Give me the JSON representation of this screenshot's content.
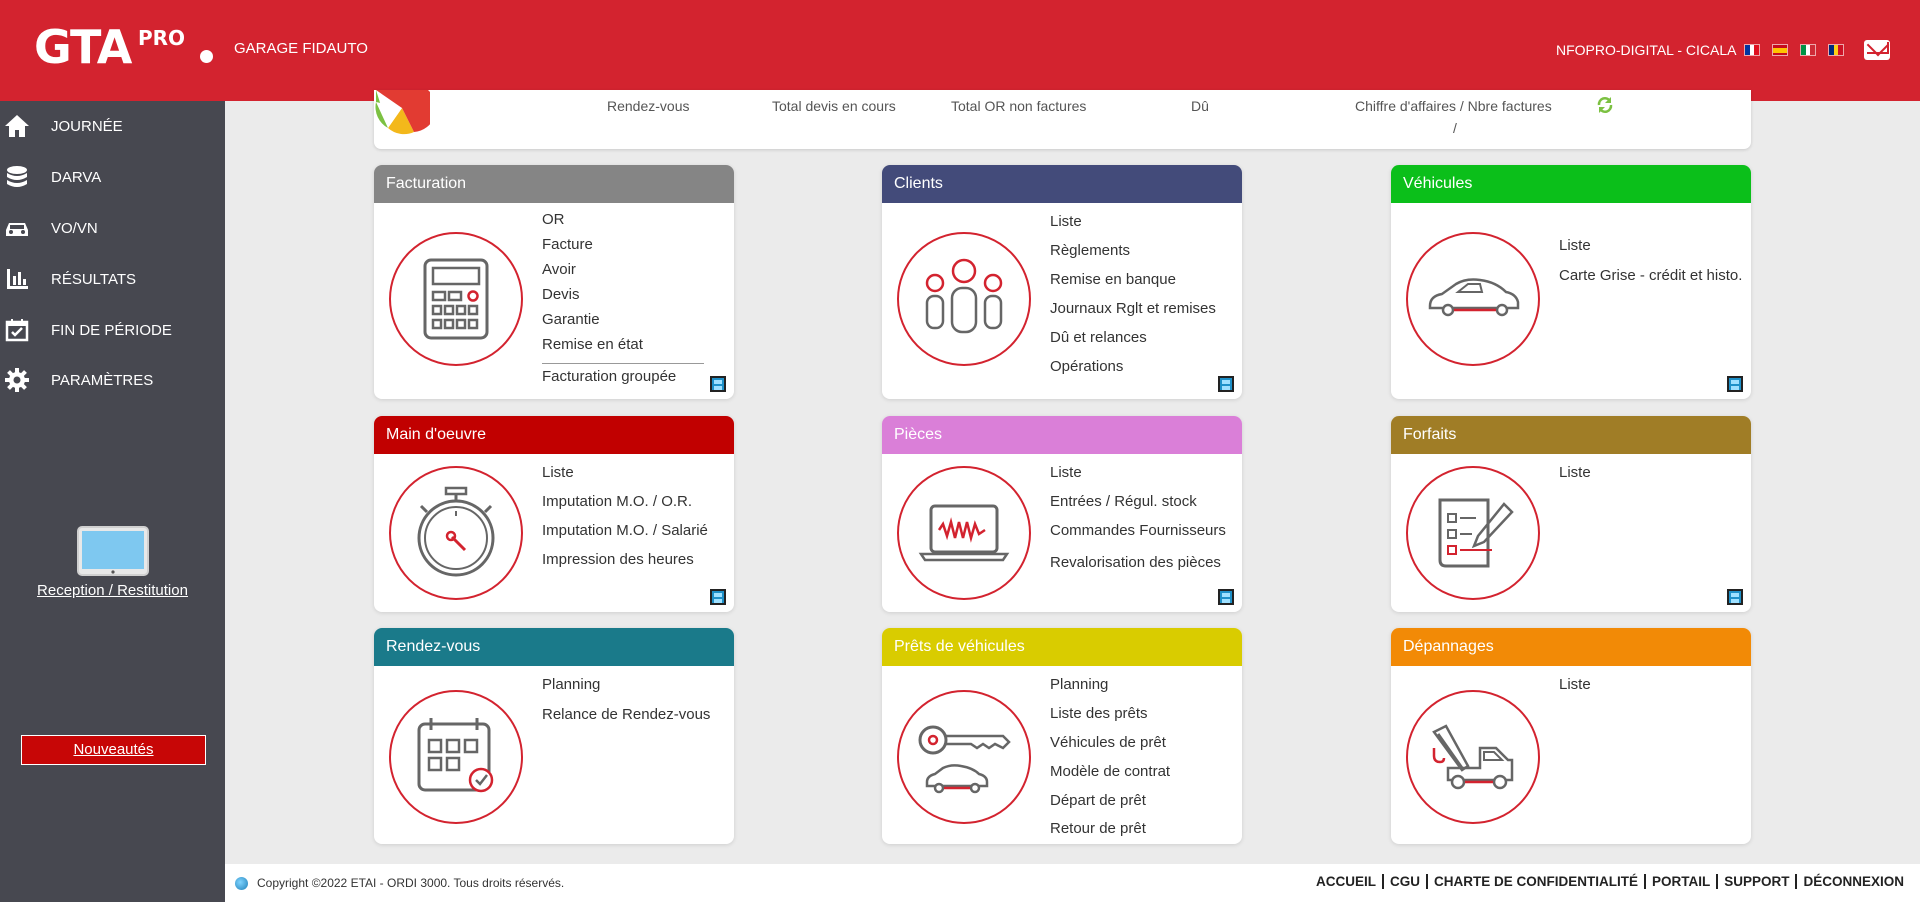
{
  "header": {
    "logo_text": "GTA",
    "logo_suffix": "PRO",
    "garage_name": "GARAGE FIDAUTO",
    "user_label": "NFOPRO-DIGITAL - CICALA"
  },
  "sidebar": {
    "items": [
      {
        "label": "JOURNÉE",
        "icon": "home-icon"
      },
      {
        "label": "DARVA",
        "icon": "database-icon"
      },
      {
        "label": "VO/VN",
        "icon": "car-icon"
      },
      {
        "label": "RÉSULTATS",
        "icon": "bar-chart-icon"
      },
      {
        "label": "FIN DE PÉRIODE",
        "icon": "calendar-check-icon"
      },
      {
        "label": "PARAMÈTRES",
        "icon": "gear-icon"
      }
    ],
    "reception_label": "Reception / Restitution",
    "news_label": "Nouveautés"
  },
  "stats": {
    "labels": [
      "Rendez-vous",
      "Total devis en cours",
      "Total OR non factures",
      "Dû",
      "Chiffre d'affaires / Nbre factures"
    ],
    "ca_value": "/"
  },
  "cards": {
    "facturation": {
      "title": "Facturation",
      "color": "#858585",
      "links": [
        "OR",
        "Facture",
        "Avoir",
        "Devis",
        "Garantie",
        "Remise en état"
      ],
      "grouped": "Facturation groupée"
    },
    "clients": {
      "title": "Clients",
      "color": "#434b7a",
      "links": [
        "Liste",
        "Règlements",
        "Remise en banque",
        "Journaux Rglt et remises",
        "Dû et relances",
        "Opérations"
      ]
    },
    "vehicules": {
      "title": "Véhicules",
      "color": "#0bbf1a",
      "links": [
        "Liste",
        "Carte Grise - crédit et histo."
      ]
    },
    "main_oeuvre": {
      "title": "Main d'oeuvre",
      "color": "#c10000",
      "links": [
        "Liste",
        "Imputation M.O. / O.R.",
        "Imputation M.O. / Salarié",
        "Impression des heures"
      ]
    },
    "pieces": {
      "title": "Pièces",
      "color": "#da7fd8",
      "links": [
        "Liste",
        "Entrées / Régul. stock",
        "Commandes Fournisseurs",
        "Revalorisation des pièces"
      ]
    },
    "forfaits": {
      "title": "Forfaits",
      "color": "#a07d26",
      "links": [
        "Liste"
      ]
    },
    "rendez_vous": {
      "title": "Rendez-vous",
      "color": "#1a7a8a",
      "links": [
        "Planning",
        "Relance de Rendez-vous"
      ]
    },
    "prets": {
      "title": "Prêts de véhicules",
      "color": "#d9cc00",
      "links": [
        "Planning",
        "Liste des prêts",
        "Véhicules de prêt",
        "Modèle de contrat",
        "Départ de prêt",
        "Retour de prêt"
      ]
    },
    "depannages": {
      "title": "Dépannages",
      "color": "#f28a06",
      "links": [
        "Liste"
      ]
    }
  },
  "footer": {
    "copyright": "Copyright ©2022 ETAI - ORDI 3000. Tous droits réservés.",
    "links": [
      "ACCUEIL",
      "CGU",
      "CHARTE DE CONFIDENTIALITÉ",
      "PORTAIL",
      "SUPPORT",
      "DÉCONNEXION"
    ]
  }
}
